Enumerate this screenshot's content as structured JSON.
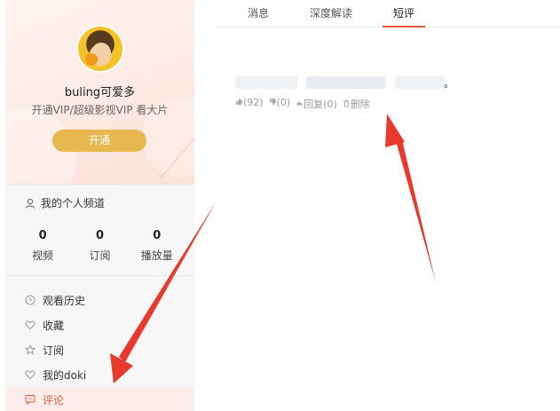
{
  "user": {
    "name": "buling可爱多",
    "vip_text": "开通VIP/超级影视VIP 看大片",
    "open_label": "开通"
  },
  "channel_label": "我的个人频道",
  "stats": [
    {
      "num": "0",
      "label": "视频"
    },
    {
      "num": "0",
      "label": "订阅"
    },
    {
      "num": "0",
      "label": "播放量"
    }
  ],
  "menu": [
    {
      "label": "观看历史",
      "icon": "clock-icon"
    },
    {
      "label": "收藏",
      "icon": "favorite-icon"
    },
    {
      "label": "订阅",
      "icon": "star-icon"
    },
    {
      "label": "我的doki",
      "icon": "heart-icon"
    },
    {
      "label": "评论",
      "icon": "comment-icon",
      "active": true
    }
  ],
  "tabs": [
    {
      "label": "消息"
    },
    {
      "label": "深度解读"
    },
    {
      "label": "短评",
      "active": true
    }
  ],
  "comment": {
    "visible_end": "。",
    "like": "(92)",
    "dislike": "(0)",
    "reply": "回复(0)",
    "delete": "删除"
  },
  "colors": {
    "accent": "#e95a3a",
    "vip_button": "#e6b84f",
    "arrow": "#e8392c"
  }
}
